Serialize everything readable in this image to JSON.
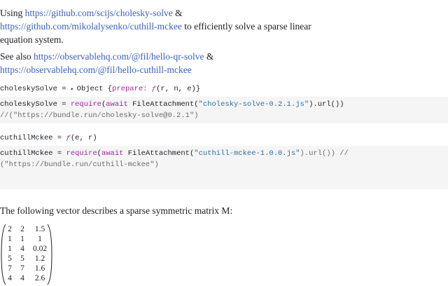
{
  "intro": {
    "using": "Using ",
    "link1": "https://github.com/scijs/cholesky-solve",
    "amp1": " &",
    "link2": "https://github.com/mikolalysenko/cuthill-mckee",
    "rest": " to efficiently solve a sparse linear equation system."
  },
  "see_also": {
    "prefix": "See also ",
    "link1": "https://observablehq.com/@fil/hello-qr-solve",
    "amp": " &",
    "link2": "https://observablehq.com/@fil/hello-cuthill-mckee"
  },
  "cells": {
    "cholesky_output": {
      "name": "choleskySolve = ",
      "triangle": "▸",
      "obj": "Object {",
      "key": "prepare:",
      "fsym": " ƒ",
      "args": "(r, n, e)}"
    },
    "cholesky_code": {
      "line1_name": "choleskySolve = ",
      "line1_require": "require",
      "line1_open": "(",
      "line1_await": "await",
      "line1_fa": " FileAttachment(",
      "line1_str": "\"cholesky-solve-0.2.1.js\"",
      "line1_end": ").url())",
      "line2": "//(\"https://bundle.run/cholesky-solve@0.2.1\")"
    },
    "cuthill_output": {
      "name": "cuthillMckee = ",
      "fsym": "ƒ",
      "args": "(e, r)"
    },
    "cuthill_code": {
      "line1_name": "cuthillMckee = ",
      "line1_require": "require",
      "line1_open": "(",
      "line1_await": "await",
      "line1_fa": " FileAttachment(",
      "line1_str": "\"cuthill-mckee-1.0.0.js\"",
      "line1_end": ").url()) //",
      "line2": "(\"https://bundle.run/cuthill-mckee\")"
    }
  },
  "vector_text": "The following vector describes a sparse symmetric matrix M:",
  "matrix": {
    "rows": [
      [
        "2",
        "2",
        "1.5"
      ],
      [
        "1",
        "1",
        "1"
      ],
      [
        "1",
        "4",
        "0.02"
      ],
      [
        "5",
        "5",
        "1.2"
      ],
      [
        "7",
        "7",
        "1.6"
      ],
      [
        "4",
        "4",
        "2.6"
      ]
    ]
  }
}
